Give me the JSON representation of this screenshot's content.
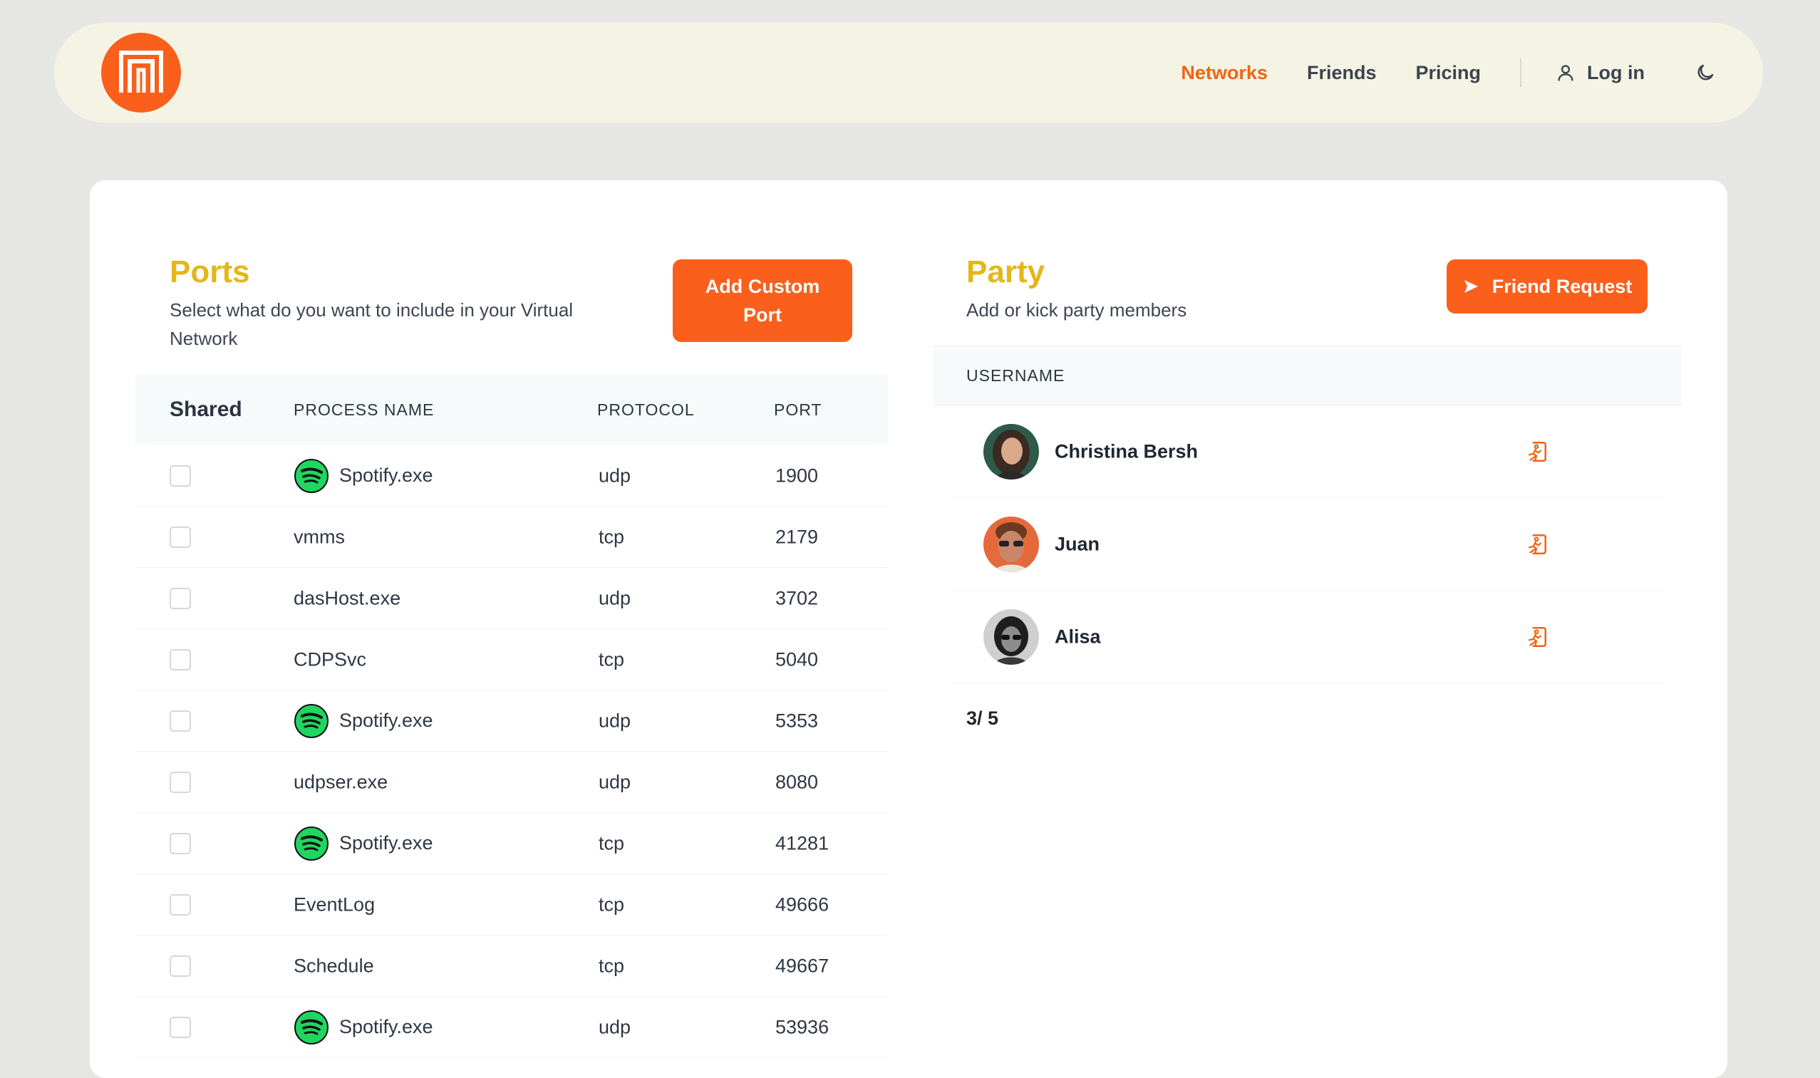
{
  "nav": {
    "links": [
      "Networks",
      "Friends",
      "Pricing"
    ],
    "login_label": "Log in",
    "accent": "#fa5f1c"
  },
  "ports": {
    "title": "Ports",
    "subtitle": "Select what do you want to include in your Virtual Network",
    "add_button": "Add Custom Port",
    "headers": {
      "shared": "Shared",
      "process": "PROCESS NAME",
      "protocol": "PROTOCOL",
      "port": "PORT"
    },
    "rows": [
      {
        "process": "Spotify.exe",
        "protocol": "udp",
        "port": "1900",
        "icon": "spotify-icon"
      },
      {
        "process": "vmms",
        "protocol": "tcp",
        "port": "2179",
        "icon": ""
      },
      {
        "process": "dasHost.exe",
        "protocol": "udp",
        "port": "3702",
        "icon": ""
      },
      {
        "process": "CDPSvc",
        "protocol": "tcp",
        "port": "5040",
        "icon": ""
      },
      {
        "process": "Spotify.exe",
        "protocol": "udp",
        "port": "5353",
        "icon": "spotify-icon"
      },
      {
        "process": "udpser.exe",
        "protocol": "udp",
        "port": "8080",
        "icon": ""
      },
      {
        "process": "Spotify.exe",
        "protocol": "tcp",
        "port": "41281",
        "icon": "spotify-icon"
      },
      {
        "process": "EventLog",
        "protocol": "tcp",
        "port": "49666",
        "icon": ""
      },
      {
        "process": "Schedule",
        "protocol": "tcp",
        "port": "49667",
        "icon": ""
      },
      {
        "process": "Spotify.exe",
        "protocol": "udp",
        "port": "53936",
        "icon": "spotify-icon"
      }
    ]
  },
  "party": {
    "title": "Party",
    "subtitle": "Add or kick party members",
    "friend_button": "Friend Request",
    "header_username": "USERNAME",
    "members": [
      {
        "name": "Christina Bersh"
      },
      {
        "name": "Juan"
      },
      {
        "name": "Alisa"
      }
    ],
    "count": "3/ 5"
  }
}
